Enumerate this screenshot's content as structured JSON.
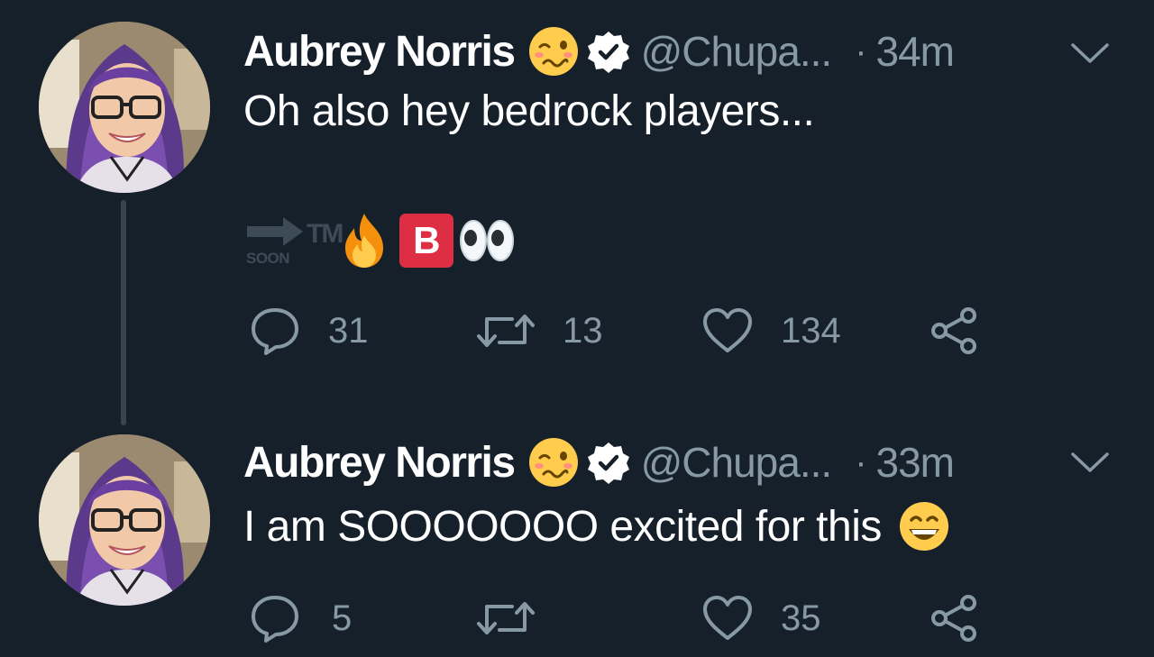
{
  "tweets": [
    {
      "display_name": "Aubrey Norris",
      "handle": "@Chupa...",
      "separator": "·",
      "time": "34m",
      "text": "Oh also hey bedrock players...",
      "sticker_text_soon": "SOON",
      "sticker_text_tm": "TM",
      "badge_letter": "B",
      "emojis": [
        "woozy-face",
        "verified-badge",
        "arrow-soon",
        "trademark",
        "fire",
        "b-button",
        "eyes"
      ],
      "reply_count": "31",
      "retweet_count": "13",
      "like_count": "134"
    },
    {
      "display_name": "Aubrey Norris",
      "handle": "@Chupa...",
      "separator": "·",
      "time": "33m",
      "text": "I am SOOOOOOO excited for this",
      "emojis": [
        "woozy-face",
        "verified-badge",
        "grinning-face"
      ],
      "reply_count": "5",
      "retweet_count": "",
      "like_count": "35"
    }
  ],
  "icons": [
    "reply-icon",
    "retweet-icon",
    "like-icon",
    "share-icon",
    "chevron-down-icon"
  ],
  "colors": {
    "background": "#15202b",
    "text": "#ffffff",
    "muted": "#8899a6",
    "thread_line": "#38444d",
    "badge_red": "#dd2e44"
  }
}
